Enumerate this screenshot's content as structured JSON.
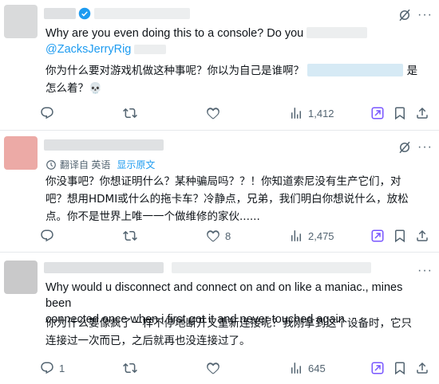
{
  "posts": [
    {
      "line1": "Why are you even doing this to a console? Do you",
      "mention": "@ZacksJerryRig",
      "cn_line1": "你为什么要对游戏机做这种事呢？你以为自己是谁啊？",
      "cn_line1_tail": "是",
      "cn_line2": "怎么着？💀",
      "replies": "",
      "reposts": "",
      "likes": "",
      "views": "1,412"
    },
    {
      "translate_label": "翻译自 英语",
      "translate_link": "显示原文",
      "cn_line1": "你没事吧？你想证明什么？某种骗局吗？？！你知道索尼没有生产它们，对",
      "cn_line2": "吧？想用HDMI或什么的拖卡车？冷静点，兄弟，我们明白你想说什么，放松",
      "cn_line3": "点。你不是世界上唯一一个做维修的家伙......",
      "replies": "",
      "reposts": "",
      "likes": "8",
      "views": "2,475"
    },
    {
      "en_line1": "Why would u disconnect and connect on and on like a maniac., mines been",
      "en_line2": "connected once when i first got it and never touched again",
      "cn_line1": "你为什么要像疯了一样不停地断开又重新连接呢？我刚拿到这个设备时，它只",
      "cn_line2": "连接过一次而已，之后就再也没连接过了。",
      "replies": "1",
      "reposts": "",
      "likes": "",
      "views": "645"
    }
  ],
  "colors": {
    "accent": "#1d9bf0",
    "muted": "#536471",
    "grok": "#7856ff"
  }
}
